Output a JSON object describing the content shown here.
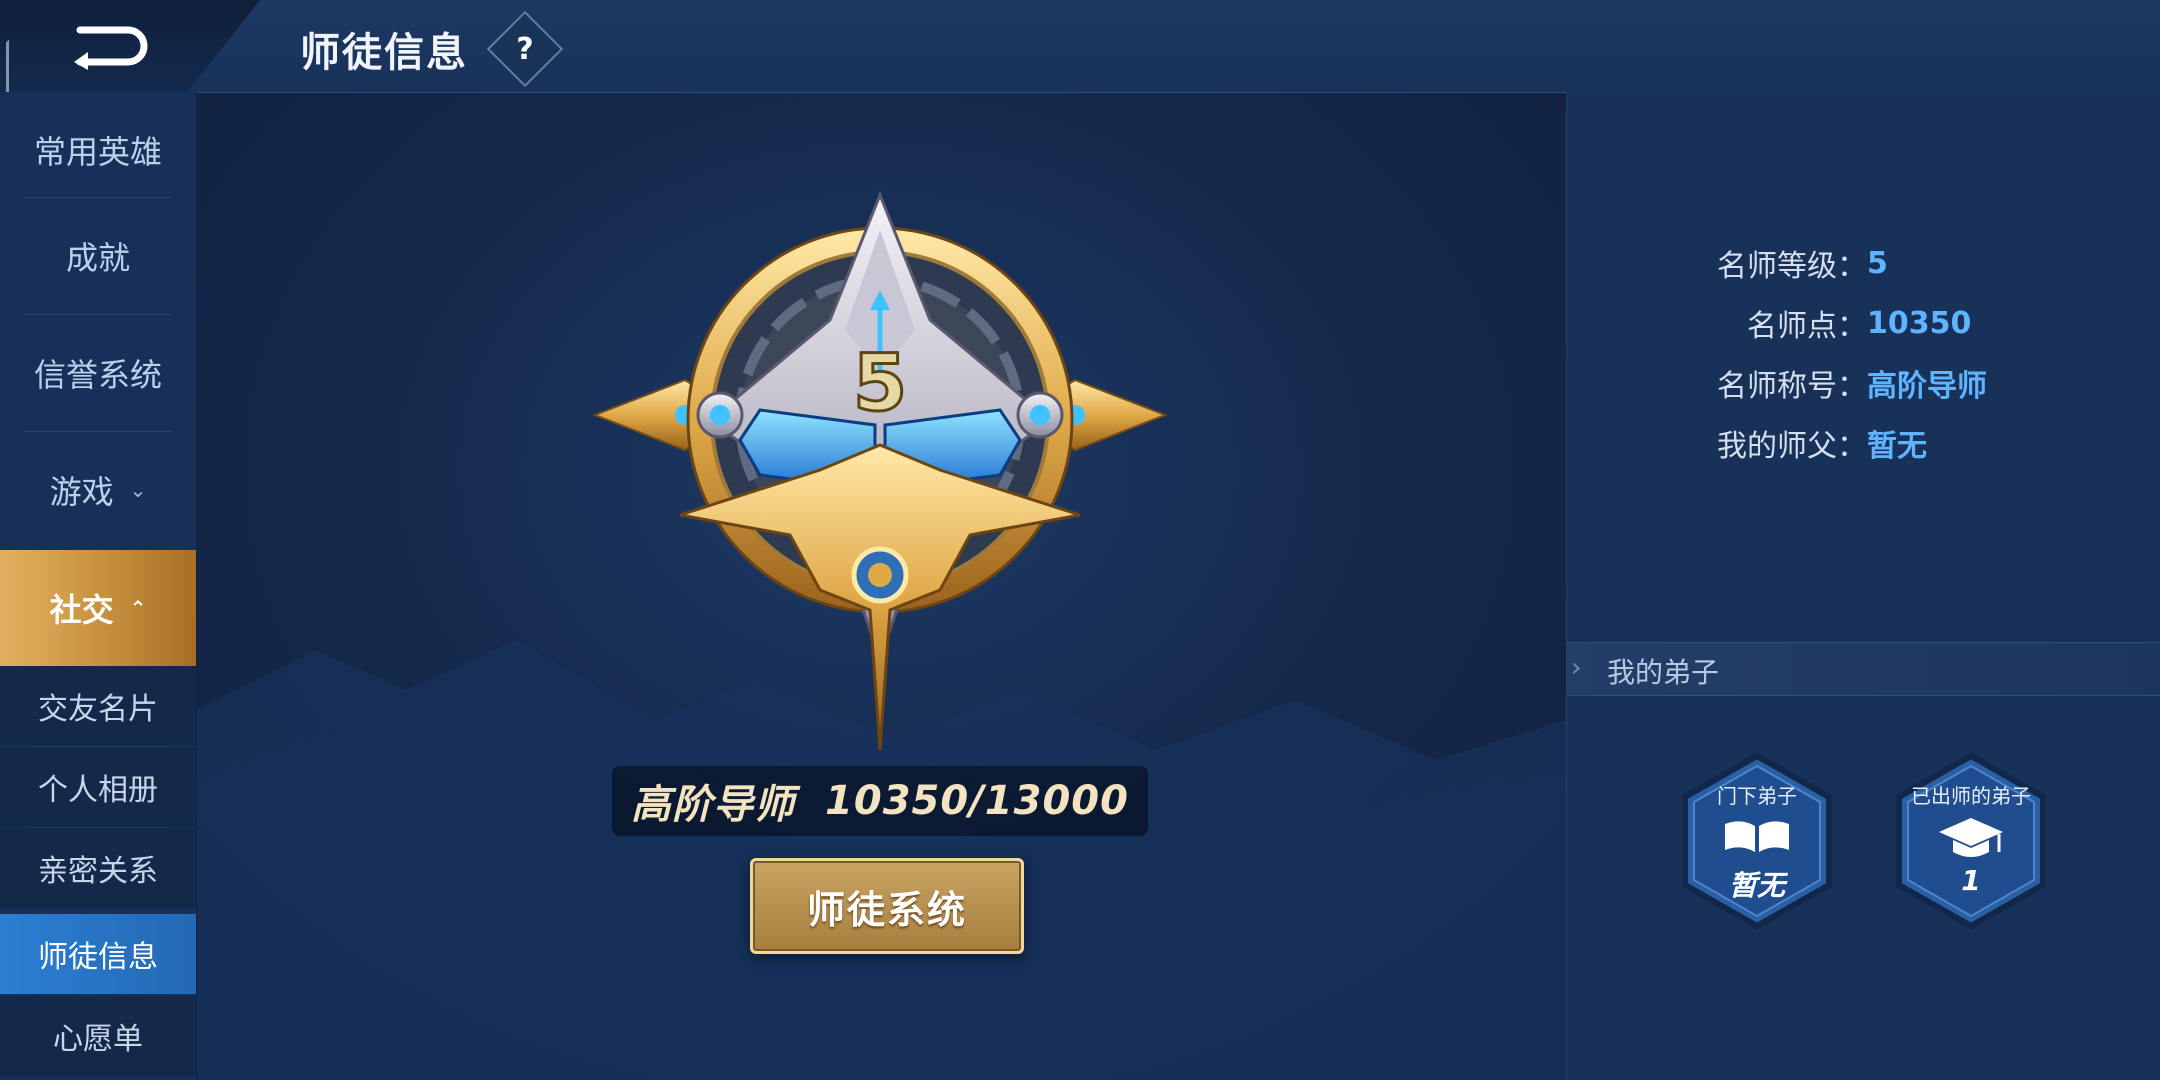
{
  "header": {
    "title": "师徒信息",
    "help_label": "?"
  },
  "sidebar": {
    "items": [
      {
        "label": "常用英雄"
      },
      {
        "label": "成就"
      },
      {
        "label": "信誉系统"
      },
      {
        "label": "游戏",
        "chevron": "⌄"
      },
      {
        "label": "社交",
        "chevron": "⌃"
      }
    ],
    "sub_items": [
      {
        "label": "交友名片"
      },
      {
        "label": "个人相册"
      },
      {
        "label": "亲密关系"
      },
      {
        "label": "师徒信息"
      },
      {
        "label": "心愿单"
      }
    ]
  },
  "badge": {
    "level": "5",
    "rank_title": "高阶导师",
    "progress_text": "10350/13000",
    "progress_fraction": 0.796
  },
  "mentor_button": {
    "label": "师徒系统"
  },
  "info": {
    "level_label": "名师等级：",
    "level_value": "5",
    "points_label": "名师点：",
    "points_value": "10350",
    "title_label": "名师称号：",
    "title_value": "高阶导师",
    "master_label": "我的师父：",
    "master_value": "暂无"
  },
  "disciples": {
    "header": "我的弟子",
    "current": {
      "title": "门下弟子",
      "value": "暂无",
      "icon": "open-book-icon"
    },
    "graduated": {
      "title": "已出师的弟子",
      "value": "1",
      "icon": "graduation-cap-icon"
    }
  },
  "colors": {
    "accent_gold": "#e2b160",
    "accent_blue": "#5fb4ff",
    "active_sub": "#2b7fd3"
  }
}
